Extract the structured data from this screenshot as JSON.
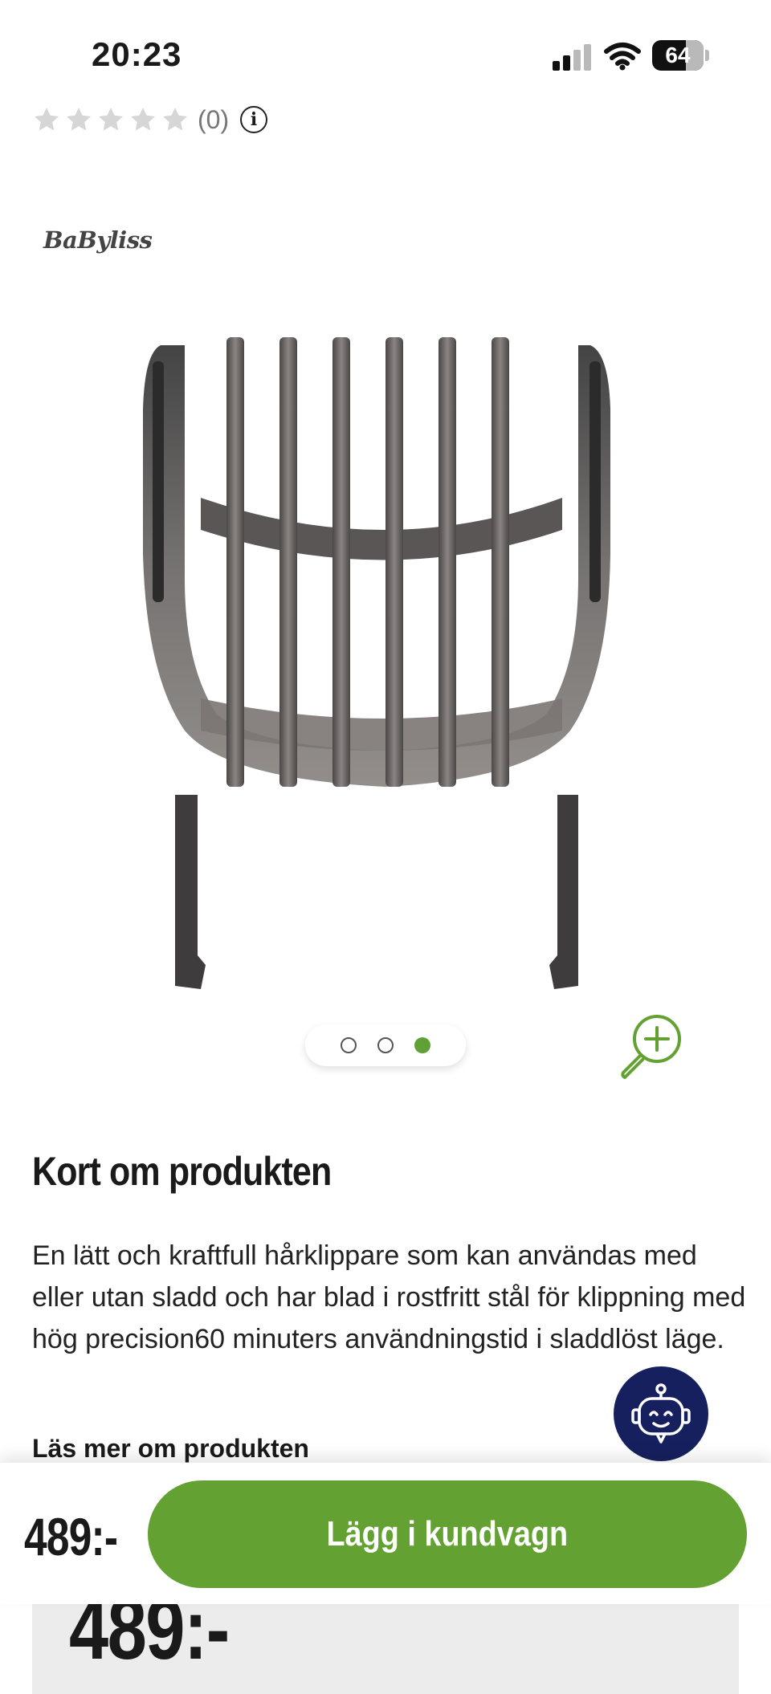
{
  "status_bar": {
    "time": "20:23",
    "battery": "64"
  },
  "rating": {
    "stars_filled": 0,
    "stars_total": 5,
    "count_text": "(0)",
    "info_glyph": "i"
  },
  "brand": {
    "logo_text": "BaByliss"
  },
  "gallery": {
    "total_images": 3,
    "active_index": 2,
    "zoom_icon": "zoom-in-icon"
  },
  "product_summary": {
    "heading": "Kort om produkten",
    "description": "En lätt och kraftfull hårklippare som kan användas med eller utan sladd och har blad i rostfritt stål för klippning med hög precision60 minuters användningstid i sladdlöst läge.",
    "read_more": "Läs mer om produkten"
  },
  "price": {
    "sticky": "489:-",
    "main": "489:-"
  },
  "cta": {
    "add_to_cart": "Lägg i kundvagn"
  },
  "colors": {
    "accent_green": "#63a132",
    "chat_navy": "#16205e",
    "star_gray": "#d6d6d6"
  },
  "icons": [
    "signal-icon",
    "wifi-icon",
    "battery-icon",
    "star-icon",
    "info-icon",
    "zoom-in-icon",
    "chat-bot-icon"
  ]
}
